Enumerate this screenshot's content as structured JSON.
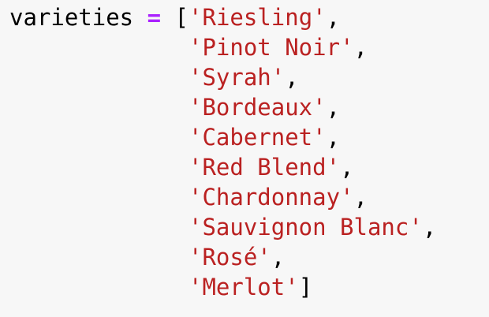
{
  "code": {
    "variable_name": "varieties",
    "assignment_operator": "=",
    "open_bracket": "[",
    "close_bracket": "]",
    "comma": ",",
    "quote": "'",
    "items": [
      "Riesling",
      "Pinot Noir",
      "Syrah",
      "Bordeaux",
      "Cabernet",
      "Red Blend",
      "Chardonnay",
      "Sauvignon Blanc",
      "Rosé",
      "Merlot"
    ]
  },
  "colors": {
    "background": "#f7f7f7",
    "identifier": "#000000",
    "operator": "#aa22ff",
    "string": "#ba2121"
  }
}
